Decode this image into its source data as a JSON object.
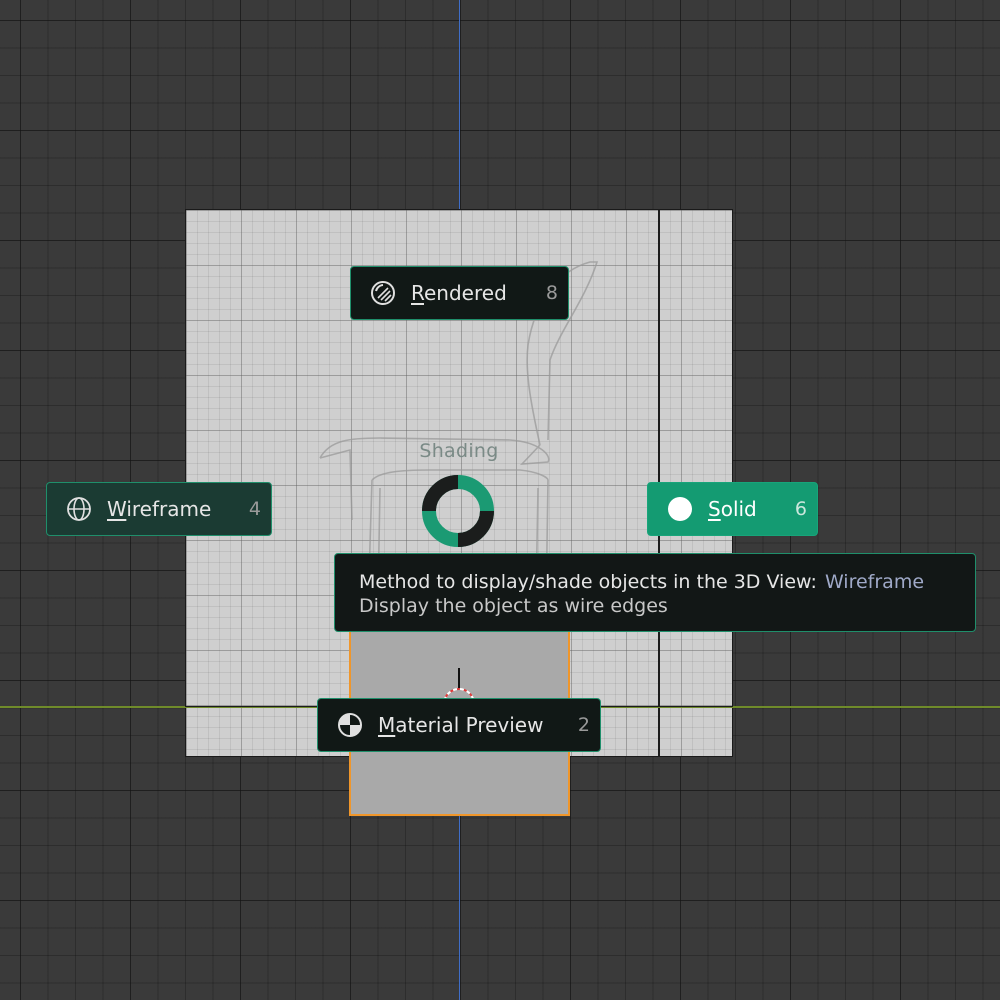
{
  "pie_menu": {
    "title": "Shading",
    "items": [
      {
        "label_first": "R",
        "label_rest": "endered",
        "key": "8",
        "icon": "rendered-shading-icon"
      },
      {
        "label_first": "W",
        "label_rest": "ireframe",
        "key": "4",
        "icon": "wireframe-globe-icon"
      },
      {
        "label_first": "S",
        "label_rest": "olid",
        "key": "6",
        "icon": "solid-sphere-icon"
      },
      {
        "label_first": "M",
        "label_rest": "aterial Preview",
        "key": "2",
        "icon": "material-preview-icon"
      }
    ],
    "highlighted": "Wireframe",
    "active": "Solid"
  },
  "tooltip": {
    "heading": "Method to display/shade objects in the 3D View:",
    "value": "Wireframe",
    "description": "Display the object as wire edges"
  },
  "colors": {
    "accent_green": "#149b72",
    "selection_orange": "#f0962a",
    "x_axis": "#6f8b2a",
    "z_axis": "#3f6ec8"
  }
}
